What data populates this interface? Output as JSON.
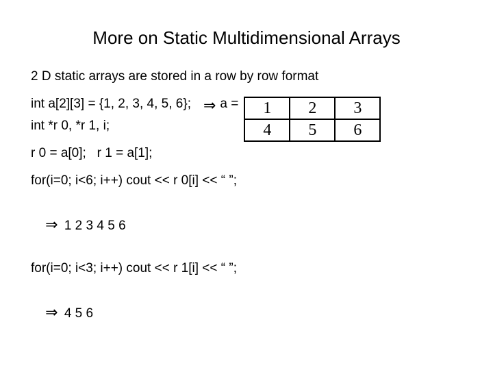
{
  "title": "More on Static Multidimensional Arrays",
  "intro": "2 D static arrays are stored in a row by row format",
  "decl1": "int a[2][3] = {1, 2, 3, 4, 5, 6};",
  "arrow1": "⇒",
  "aeq": "a =",
  "table": {
    "r0": [
      "1",
      "2",
      "3"
    ],
    "r1": [
      "4",
      "5",
      "6"
    ]
  },
  "decl2": "int *r 0, *r 1, i;",
  "assign": "r 0 = a[0];   r 1 = a[1];",
  "loop1": "for(i=0; i<6; i++) cout << r 0[i] << “ ”;",
  "out1_arrow": "⇒",
  "out1": " 1 2 3 4 5 6",
  "loop2": "for(i=0; i<3; i++) cout << r 1[i] << “ ”;",
  "out2_arrow": "⇒",
  "out2": " 4 5 6"
}
